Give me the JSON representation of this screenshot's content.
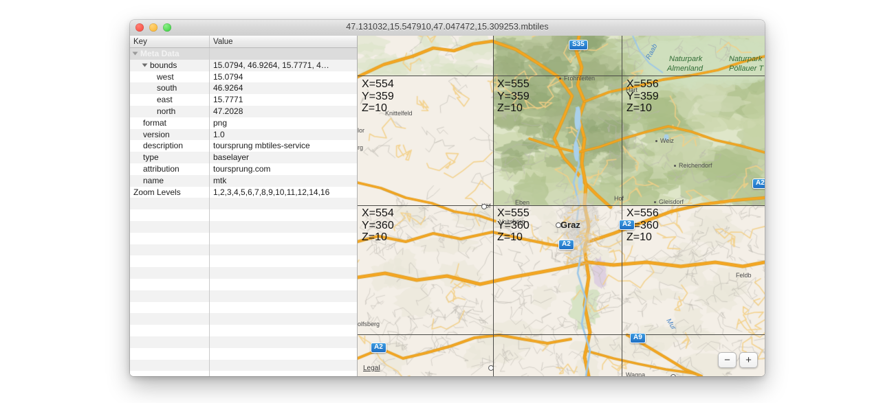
{
  "window": {
    "title": "47.131032,15.547910,47.047472,15.309253.mbtiles",
    "close_label": "",
    "minimize_label": "",
    "maximize_label": ""
  },
  "table": {
    "columns": [
      "Key",
      "Value"
    ],
    "rows": [
      {
        "key": "Meta Data",
        "value": "",
        "indent": 0,
        "group": true,
        "disclosure": "down"
      },
      {
        "key": "bounds",
        "value": "15.0794, 46.9264, 15.7771, 4…",
        "indent": 1,
        "group": false,
        "disclosure": "down"
      },
      {
        "key": "west",
        "value": "15.0794",
        "indent": 2,
        "group": false,
        "disclosure": ""
      },
      {
        "key": "south",
        "value": "46.9264",
        "indent": 2,
        "group": false,
        "disclosure": ""
      },
      {
        "key": "east",
        "value": "15.7771",
        "indent": 2,
        "group": false,
        "disclosure": ""
      },
      {
        "key": "north",
        "value": "47.2028",
        "indent": 2,
        "group": false,
        "disclosure": ""
      },
      {
        "key": "format",
        "value": "png",
        "indent": 1,
        "group": false,
        "disclosure": ""
      },
      {
        "key": "version",
        "value": "1.0",
        "indent": 1,
        "group": false,
        "disclosure": ""
      },
      {
        "key": "description",
        "value": "toursprung mbtiles-service",
        "indent": 1,
        "group": false,
        "disclosure": ""
      },
      {
        "key": "type",
        "value": "baselayer",
        "indent": 1,
        "group": false,
        "disclosure": ""
      },
      {
        "key": "attribution",
        "value": "toursprung.com",
        "indent": 1,
        "group": false,
        "disclosure": ""
      },
      {
        "key": "name",
        "value": "mtk",
        "indent": 1,
        "group": false,
        "disclosure": ""
      },
      {
        "key": "Zoom Levels",
        "value": "1,2,3,4,5,6,7,8,9,10,11,12,14,16",
        "indent": 0,
        "group": false,
        "disclosure": ""
      }
    ],
    "empty_row_count": 16
  },
  "map": {
    "tiles": [
      {
        "x": "X=554",
        "y": "Y=359",
        "z": "Z=10"
      },
      {
        "x": "X=555",
        "y": "Y=359",
        "z": "Z=10"
      },
      {
        "x": "X=556",
        "y": "Y=359",
        "z": "Z=10"
      },
      {
        "x": "X=554",
        "y": "Y=360",
        "z": "Z=10"
      },
      {
        "x": "X=555",
        "y": "Y=360",
        "z": "Z=10"
      },
      {
        "x": "X=556",
        "y": "Y=360",
        "z": "Z=10"
      }
    ],
    "places": [
      "Knittelfeld",
      "Frohnleiten",
      "Weiz",
      "Reichendorf",
      "Gleisdorf",
      "Graz",
      "Eben",
      "Hof",
      "Voitsberg",
      "Köf",
      "olfsberg",
      "Feldb",
      "Wagna",
      "Hart",
      "rg",
      "lor"
    ],
    "parks": [
      "Naturpark Almenland",
      "Naturpark Pöllauer T"
    ],
    "rivers": [
      "Raab",
      "Mur"
    ],
    "shields": [
      "S35",
      "A2",
      "A2",
      "A2",
      "A9",
      "A2"
    ],
    "legal_label": "Legal",
    "zoom_out_label": "−",
    "zoom_in_label": "+"
  },
  "colors": {
    "road_major": "#f5a623",
    "shield_blue": "#2178c8",
    "map_land": "#f4efe7",
    "map_forest": "#c9d7ae",
    "grid": "#4a4a46"
  }
}
